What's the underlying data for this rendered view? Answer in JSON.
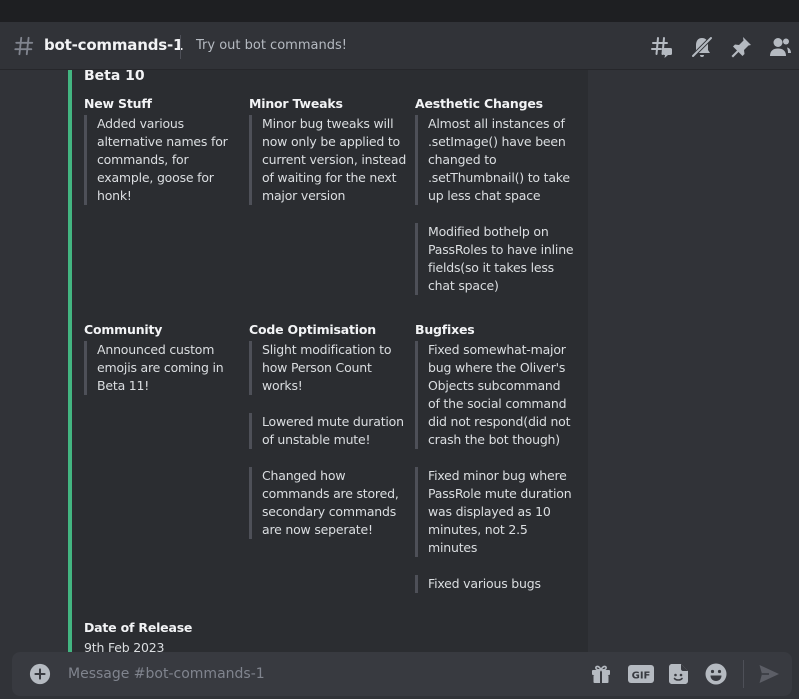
{
  "header": {
    "channel_name": "bot-commands-1",
    "topic": "Try out bot commands!",
    "icons": [
      "threads-icon",
      "notification-muted-icon",
      "pin-icon",
      "member-list-icon"
    ]
  },
  "embed": {
    "title": "Beta 10",
    "accent_color": "#43b581",
    "fields": {
      "new_stuff": {
        "name": "New Stuff",
        "items": [
          "Added various alternative names for commands, for example, goose for honk!"
        ]
      },
      "minor_tweaks": {
        "name": "Minor Tweaks",
        "items": [
          "Minor bug tweaks will now only be applied to current version, instead of waiting for the next major version"
        ]
      },
      "aesthetic_changes": {
        "name": "Aesthetic Changes",
        "items": [
          "Almost all instances of .setImage() have been changed to .setThumbnail() to take up less chat space",
          "Modified bothelp on PassRoles to have inline fields(so it takes less chat space)"
        ]
      },
      "community": {
        "name": "Community",
        "items": [
          "Announced custom emojis are coming in Beta 11!"
        ]
      },
      "code_optimisation": {
        "name": "Code Optimisation",
        "items": [
          "Slight modification to how Person Count works!",
          "Lowered mute duration of unstable mute!",
          "Changed how commands are stored, secondary commands are now seperate!"
        ]
      },
      "bugfixes": {
        "name": "Bugfixes",
        "items": [
          "Fixed somewhat-major bug where the Oliver's Objects subcommand of the social command did not respond(did not crash the bot though)",
          "Fixed minor bug where PassRole mute duration was displayed as 10 minutes, not 2.5 minutes",
          "Fixed various bugs"
        ]
      },
      "date_of_release": {
        "name": "Date of Release",
        "value": "9th Feb 2023"
      }
    }
  },
  "composer": {
    "placeholder": "Message #bot-commands-1",
    "icons": [
      "add-icon",
      "gift-icon",
      "gif-icon",
      "sticker-icon",
      "emoji-icon",
      "send-icon"
    ]
  }
}
